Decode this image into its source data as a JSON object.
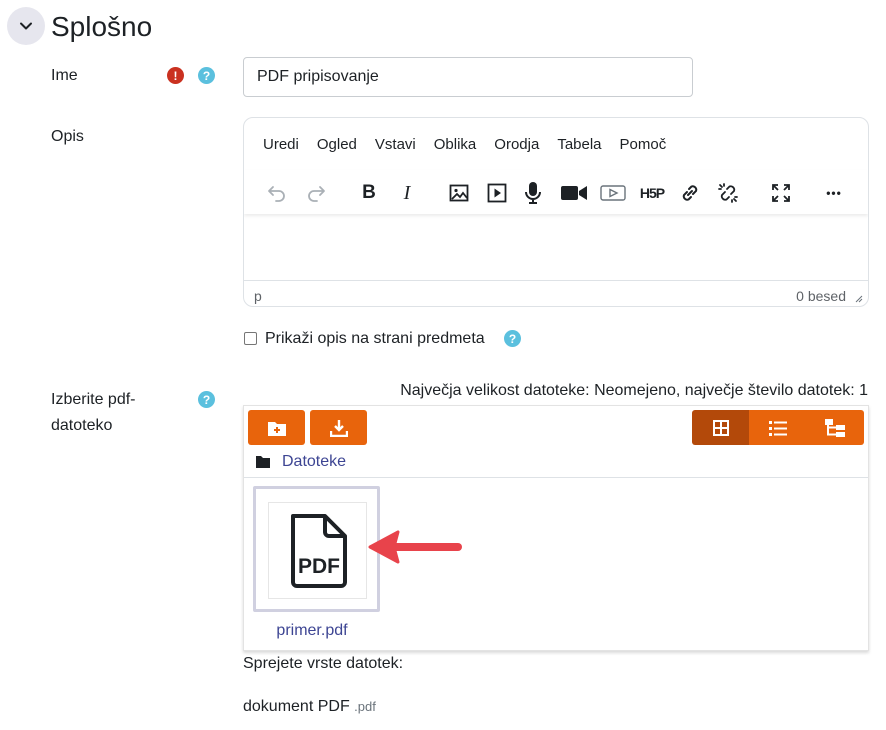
{
  "section": {
    "title": "Splošno",
    "collapse_icon": "chevron-down-icon"
  },
  "name_field": {
    "label": "Ime",
    "value": "PDF pripisovanje",
    "required_icon": "exclamation-icon",
    "help_icon": "question-icon"
  },
  "description": {
    "label": "Opis",
    "menu": [
      "Uredi",
      "Ogled",
      "Vstavi",
      "Oblika",
      "Orodja",
      "Tabela",
      "Pomoč"
    ],
    "toolbar_icons": [
      "undo-icon",
      "redo-icon",
      "bold-icon",
      "italic-icon",
      "image-icon",
      "media-icon",
      "microphone-icon",
      "video-camera-icon",
      "embed-video-icon",
      "h5p-icon",
      "link-icon",
      "unlink-icon",
      "fullscreen-icon",
      "more-icon"
    ],
    "bold_glyph": "B",
    "italic_glyph": "I",
    "h5p_glyph": "H5P",
    "more_glyph": "•••",
    "status_path": "p",
    "word_count": "0 besed"
  },
  "show_description": {
    "label": "Prikaži opis na strani predmeta",
    "checked": false
  },
  "file_picker": {
    "label_line1": "Izberite pdf-",
    "label_line2": "datoteko",
    "limits": "Največja velikost datoteke: Neomejeno, največje število datotek: 1",
    "breadcrumb": "Datoteke",
    "add_icon": "add-file-icon",
    "download_icon": "download-icon",
    "views": [
      "grid-view-icon",
      "list-view-icon",
      "tree-view-icon"
    ],
    "active_view": "grid-view-icon",
    "file": {
      "name": "primer.pdf",
      "icon": "pdf-file-icon",
      "icon_text": "PDF"
    }
  },
  "accepted_types": {
    "title": "Sprejete vrste datotek:",
    "type_name": "dokument PDF",
    "extension": ".pdf"
  },
  "colors": {
    "accent": "#e8640c",
    "accent_active": "#b3490a",
    "link": "#3d4593",
    "required": "#ca3120",
    "help": "#5bc0de",
    "arrow": "#e8434b"
  }
}
